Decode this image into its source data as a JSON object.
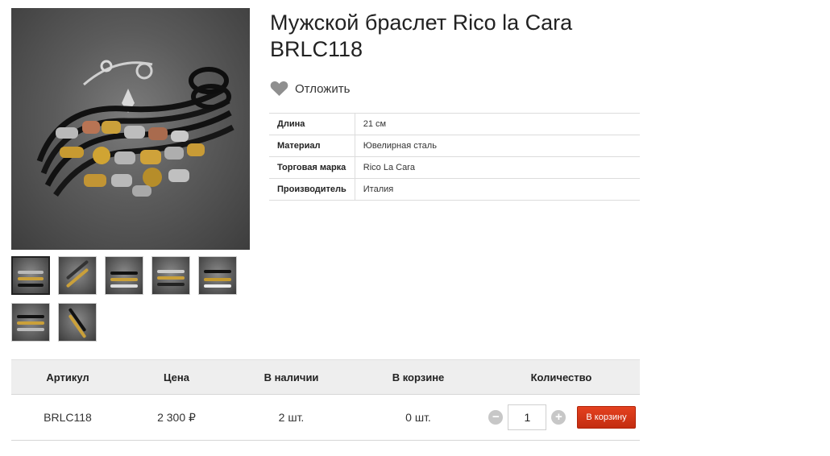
{
  "product": {
    "title": "Мужской браслет Rico la Cara BRLC118",
    "wishlist_label": "Отложить",
    "main_image_icon": "bracelet-photo",
    "thumbnail_count": 7
  },
  "properties": [
    {
      "key": "Длина",
      "value": "21 см"
    },
    {
      "key": "Материал",
      "value": "Ювелирная сталь"
    },
    {
      "key": "Торговая марка",
      "value": "Rico La Cara"
    },
    {
      "key": "Производитель",
      "value": "Италия"
    }
  ],
  "buy_table": {
    "headers": [
      "Артикул",
      "Цена",
      "В наличии",
      "В корзине",
      "Количество"
    ],
    "row": {
      "sku": "BRLC118",
      "price": "2 300 ₽",
      "stock": "2 шт.",
      "in_cart": "0 шт.",
      "quantity": "1"
    },
    "minus_label": "−",
    "plus_label": "+",
    "add_to_cart_label": "В корзину"
  },
  "colors": {
    "accent": "#d9391a",
    "heart": "#8f8f8f",
    "header_bg": "#eeeeee"
  }
}
